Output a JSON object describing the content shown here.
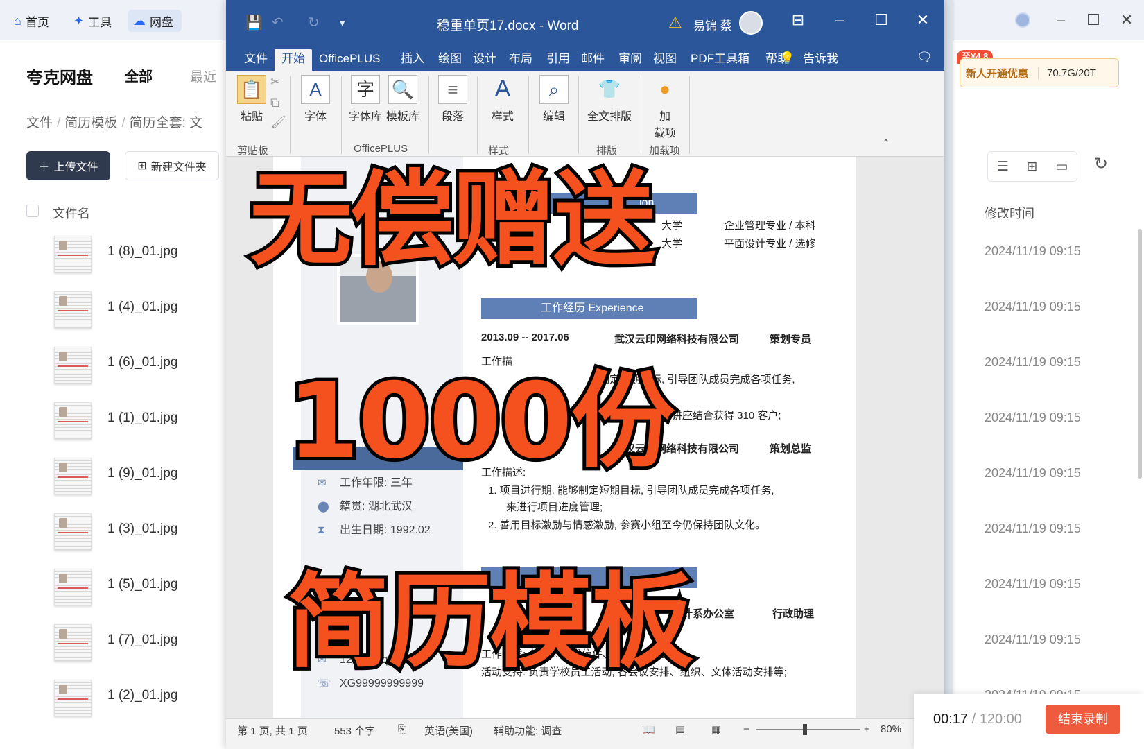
{
  "app": {
    "tabs": [
      {
        "label": "首页",
        "icon": "home-icon"
      },
      {
        "label": "工具",
        "icon": "sparkle-icon"
      },
      {
        "label": "网盘",
        "icon": "cloud-icon"
      }
    ],
    "brand": "夸克网盘",
    "nav_all": "全部",
    "nav_recent": "最近",
    "breadcrumb": [
      "文件",
      "简历模板",
      "简历全套: 文"
    ],
    "upload_label": "上传文件",
    "new_folder_label": "新建文件夹",
    "col_name": "文件名",
    "col_time": "修改时间",
    "promo_badge": "至¥4.8",
    "promo_text": "新人开通优惠",
    "quota": "70.7G/20T",
    "files": [
      {
        "name": "1 (8)_01.jpg",
        "time": "2024/11/19 09:15"
      },
      {
        "name": "1 (4)_01.jpg",
        "time": "2024/11/19 09:15"
      },
      {
        "name": "1 (6)_01.jpg",
        "time": "2024/11/19 09:15"
      },
      {
        "name": "1 (1)_01.jpg",
        "time": "2024/11/19 09:15"
      },
      {
        "name": "1 (9)_01.jpg",
        "time": "2024/11/19 09:15"
      },
      {
        "name": "1 (3)_01.jpg",
        "time": "2024/11/19 09:15"
      },
      {
        "name": "1 (5)_01.jpg",
        "time": "2024/11/19 09:15"
      },
      {
        "name": "1 (7)_01.jpg",
        "time": "2024/11/19 09:15"
      },
      {
        "name": "1 (2)_01.jpg",
        "time": "2024/11/19 09:15"
      }
    ]
  },
  "recorder": {
    "elapsed": "00:17",
    "total": "/ 120:00",
    "stop_label": "结束录制"
  },
  "word": {
    "doc_title": "稳重单页17.docx  -  Word",
    "user": "易锦 蔡",
    "menu": [
      "文件",
      "开始",
      "OfficePLUS",
      "插入",
      "绘图",
      "设计",
      "布局",
      "引用",
      "邮件",
      "审阅",
      "视图",
      "PDF工具箱",
      "帮助",
      "告诉我"
    ],
    "active_menu": "开始",
    "ribbon": {
      "paste": "粘贴",
      "font": "字体",
      "font_lib": "字体库",
      "template_lib": "模板库",
      "paragraph": "段落",
      "style": "样式",
      "edit": "编辑",
      "layout_all": "全文排版",
      "addin": "加\n载项",
      "group_clipboard": "剪贴板",
      "group_officeplus": "OfficePLUS",
      "group_style": "样式",
      "group_layout": "排版",
      "group_addin": "加载项"
    },
    "resume": {
      "edu_header": "ion",
      "edu1_school": "大学",
      "edu1_major": "企业管理专业 / 本科",
      "edu2_school": "大学",
      "edu2_major": "平面设计专业 / 选修",
      "exp_header": "工作经历    Experience",
      "job1_period": "2013.09 -- 2017.06",
      "job1_company": "武汉云印网络科技有限公司",
      "job1_role": "策划专员",
      "job1_desc_label": "工作描",
      "job1_line1": "制定短期目标, 引导团队成员完成各项任务,",
      "job1_line2": "则期利用微博与讲座结合获得 310 客户;",
      "job2_period": "013",
      "job2_company": "武汉云印网络科技有限公司",
      "job2_role": "策划总监",
      "job2_desc_label": "工作描述:",
      "job2_item1a": "1.  项目进行期, 能够制定短期目标, 引导团队成员完成各项任务,",
      "job2_item1b": "来进行项目进度管理;",
      "job2_item2": "2.  善用目标激励与情感激励, 参赛小组至今仍保持团队文化。",
      "job3_company": "计系办公室",
      "job3_role": "行政助理",
      "job3_line1": "工作描述: 负责... 收发信件、文件、快递等;",
      "job3_line2": "活动支持: 负责学校员工活动, 各会议安排、组织、文体活动安排等;",
      "info_years": "工作年限: 三年",
      "info_origin": "籍贯: 湖北武汉",
      "info_birth": "出生日期: 1992.02",
      "info_email": "12306@qq.com",
      "info_phone": "XG99999999999"
    },
    "status": {
      "page": "第 1 页, 共 1 页",
      "words": "553 个字",
      "lang": "英语(美国)",
      "a11y": "辅助功能: 调查",
      "zoom": "80%"
    }
  },
  "overlay": {
    "line1": "无偿赠送",
    "line2": "1000份",
    "line3": "简历模板"
  }
}
